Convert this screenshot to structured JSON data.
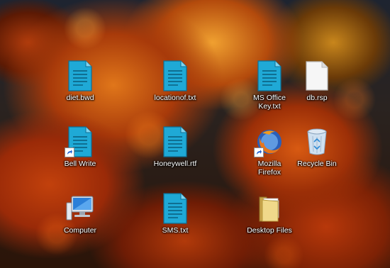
{
  "desktop": {
    "icons": [
      {
        "label": "diet.bwd",
        "icon": "document-icon"
      },
      {
        "label": "locationof.txt",
        "icon": "document-icon"
      },
      {
        "label": "MS Office\nKey.txt",
        "icon": "document-icon"
      },
      {
        "label": "db.rsp",
        "icon": "blank-file-icon"
      },
      {
        "label": "Bell Write",
        "icon": "document-shortcut-icon"
      },
      {
        "label": "Honeywell.rtf",
        "icon": "document-icon"
      },
      {
        "label": "Mozilla\nFirefox",
        "icon": "firefox-icon"
      },
      {
        "label": "Recycle Bin",
        "icon": "recycle-bin-icon"
      },
      {
        "label": "Computer",
        "icon": "computer-icon"
      },
      {
        "label": "SMS.txt",
        "icon": "document-icon"
      },
      {
        "label": "Desktop Files",
        "icon": "folder-icon"
      }
    ]
  },
  "colors": {
    "document_blue": "#1fa9d6",
    "label_text": "#ffffff"
  }
}
